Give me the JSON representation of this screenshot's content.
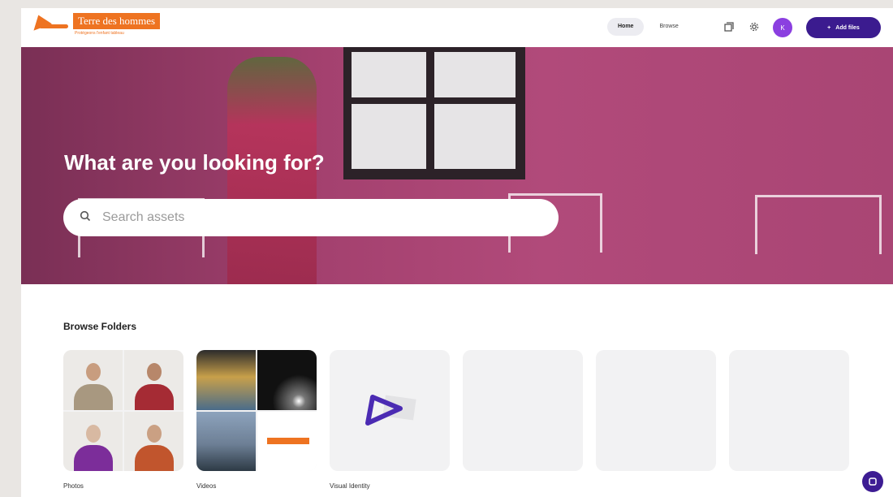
{
  "header": {
    "logo_title": "Terre des hommes",
    "logo_subtitle": "Protégeons l'enfant tableau",
    "tabs": [
      {
        "label": "Home",
        "active": true
      },
      {
        "label": "Browse",
        "active": false
      }
    ],
    "avatar_initial": "K",
    "add_button_label": "Add files",
    "add_button_icon": "plus-icon"
  },
  "hero": {
    "title": "What are you looking for?",
    "search_placeholder": "Search assets"
  },
  "browse": {
    "title": "Browse Folders",
    "folders": [
      {
        "label": "Photos"
      },
      {
        "label": "Videos"
      },
      {
        "label": "Visual Identity"
      },
      {
        "label": ""
      },
      {
        "label": ""
      },
      {
        "label": ""
      }
    ]
  },
  "colors": {
    "brand_orange": "#ee7321",
    "primary_purple": "#3b1b8f",
    "avatar_purple": "#8b3fe0",
    "hero_magenta": "#a4416f"
  },
  "icons": [
    "search-icon",
    "library-icon",
    "gear-icon",
    "plus-icon",
    "chat-icon",
    "play-triangle-icon"
  ]
}
